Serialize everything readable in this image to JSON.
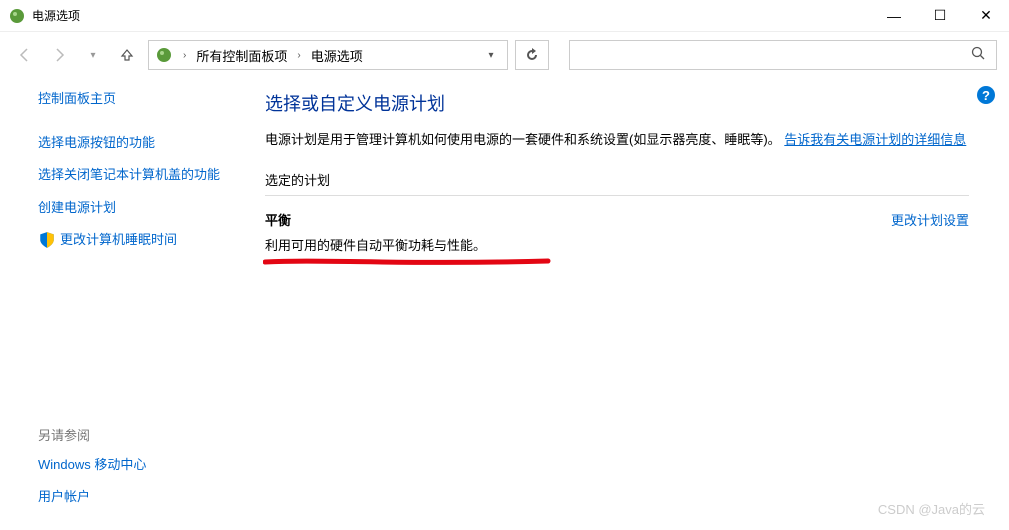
{
  "window": {
    "title": "电源选项",
    "minimize": "—",
    "maximize": "☐",
    "close": "✕"
  },
  "breadcrumb": {
    "item1": "所有控制面板项",
    "item2": "电源选项"
  },
  "sidebar": {
    "home": "控制面板主页",
    "link1": "选择电源按钮的功能",
    "link2": "选择关闭笔记本计算机盖的功能",
    "link3": "创建电源计划",
    "link4": "更改计算机睡眠时间",
    "seeAlsoTitle": "另请参阅",
    "seeAlso1": "Windows 移动中心",
    "seeAlso2": "用户帐户"
  },
  "main": {
    "heading": "选择或自定义电源计划",
    "descPrefix": "电源计划是用于管理计算机如何使用电源的一套硬件和系统设置(如显示器亮度、睡眠等)。",
    "descLink": "告诉我有关电源计划的详细信息",
    "sectionTitle": "选定的计划",
    "planName": "平衡",
    "planDesc": "利用可用的硬件自动平衡功耗与性能。",
    "changeLink": "更改计划设置"
  },
  "watermark": "CSDN @Java的云"
}
